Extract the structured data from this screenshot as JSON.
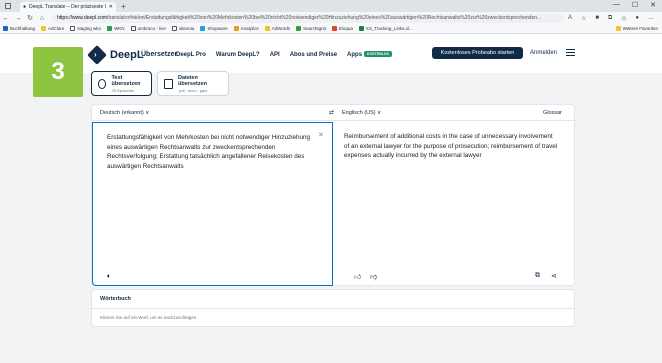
{
  "browser": {
    "tab_title": "DeepL Translate – Der präziseste Übersetzer",
    "url_domain": "https://www.deepl.com",
    "url_path": "/translator#de/en/Erstattungsfähigkeit%20von%20Mehrkosten%20bei%20nicht%20notwendiger%20Hinzuziehung%20eines%20auswärtigen%20Rechtsanwalts%20zur%20zweckentsprechenden...",
    "bookmarks": [
      "Buchhaltung",
      "AdClare",
      "staging wko",
      "WKN",
      "umbraco - live",
      "siteonia",
      "Shopware",
      "Analytics",
      "AdWords",
      "SearchIgnit",
      "Eloqua",
      "XS_Tracking_Links.xl..."
    ],
    "other_favorites": "Weitere Favoriten"
  },
  "header": {
    "brand": "DeepL",
    "brand_sub": "Übersetzer",
    "nav": [
      "DeepL Pro",
      "Warum DeepL?",
      "API",
      "Abos und Preise",
      "Apps"
    ],
    "apps_badge": "KOSTENLOS",
    "cta": "Kostenloses Probeabo starten",
    "login": "Anmelden"
  },
  "step_number": "3",
  "modes": {
    "text": {
      "title": "Text übersetzen",
      "sub": "29 Sprachen"
    },
    "files": {
      "title": "Dateien übersetzen",
      "sub": ".pdf, .docx, .pptx"
    }
  },
  "translator": {
    "source_lang": "Deutsch (erkannt) ∨",
    "target_lang": "Englisch (US) ∨",
    "glossary": "Glossar",
    "source_text": "Erstattungsfähigkeit von Mehrkosten bei nicht notwendiger Hinzuziehung eines auswärtigen Rechtsanwalts zur zweckentsprechenden Rechtsverfolgung; Erstattung tatsächlich angefallener Reisekosten des auswärtigen Rechtsanwalts",
    "target_text": "Reimbursement of additional costs in the case of unnecessary involvement of an external lawyer for the purpose of prosecution; reimbursement of travel expenses actually incurred by the external lawyer"
  },
  "dictionary": {
    "title": "Wörterbuch",
    "hint": "Klicken Sie auf ein Wort, um es nachzuschlagen."
  }
}
